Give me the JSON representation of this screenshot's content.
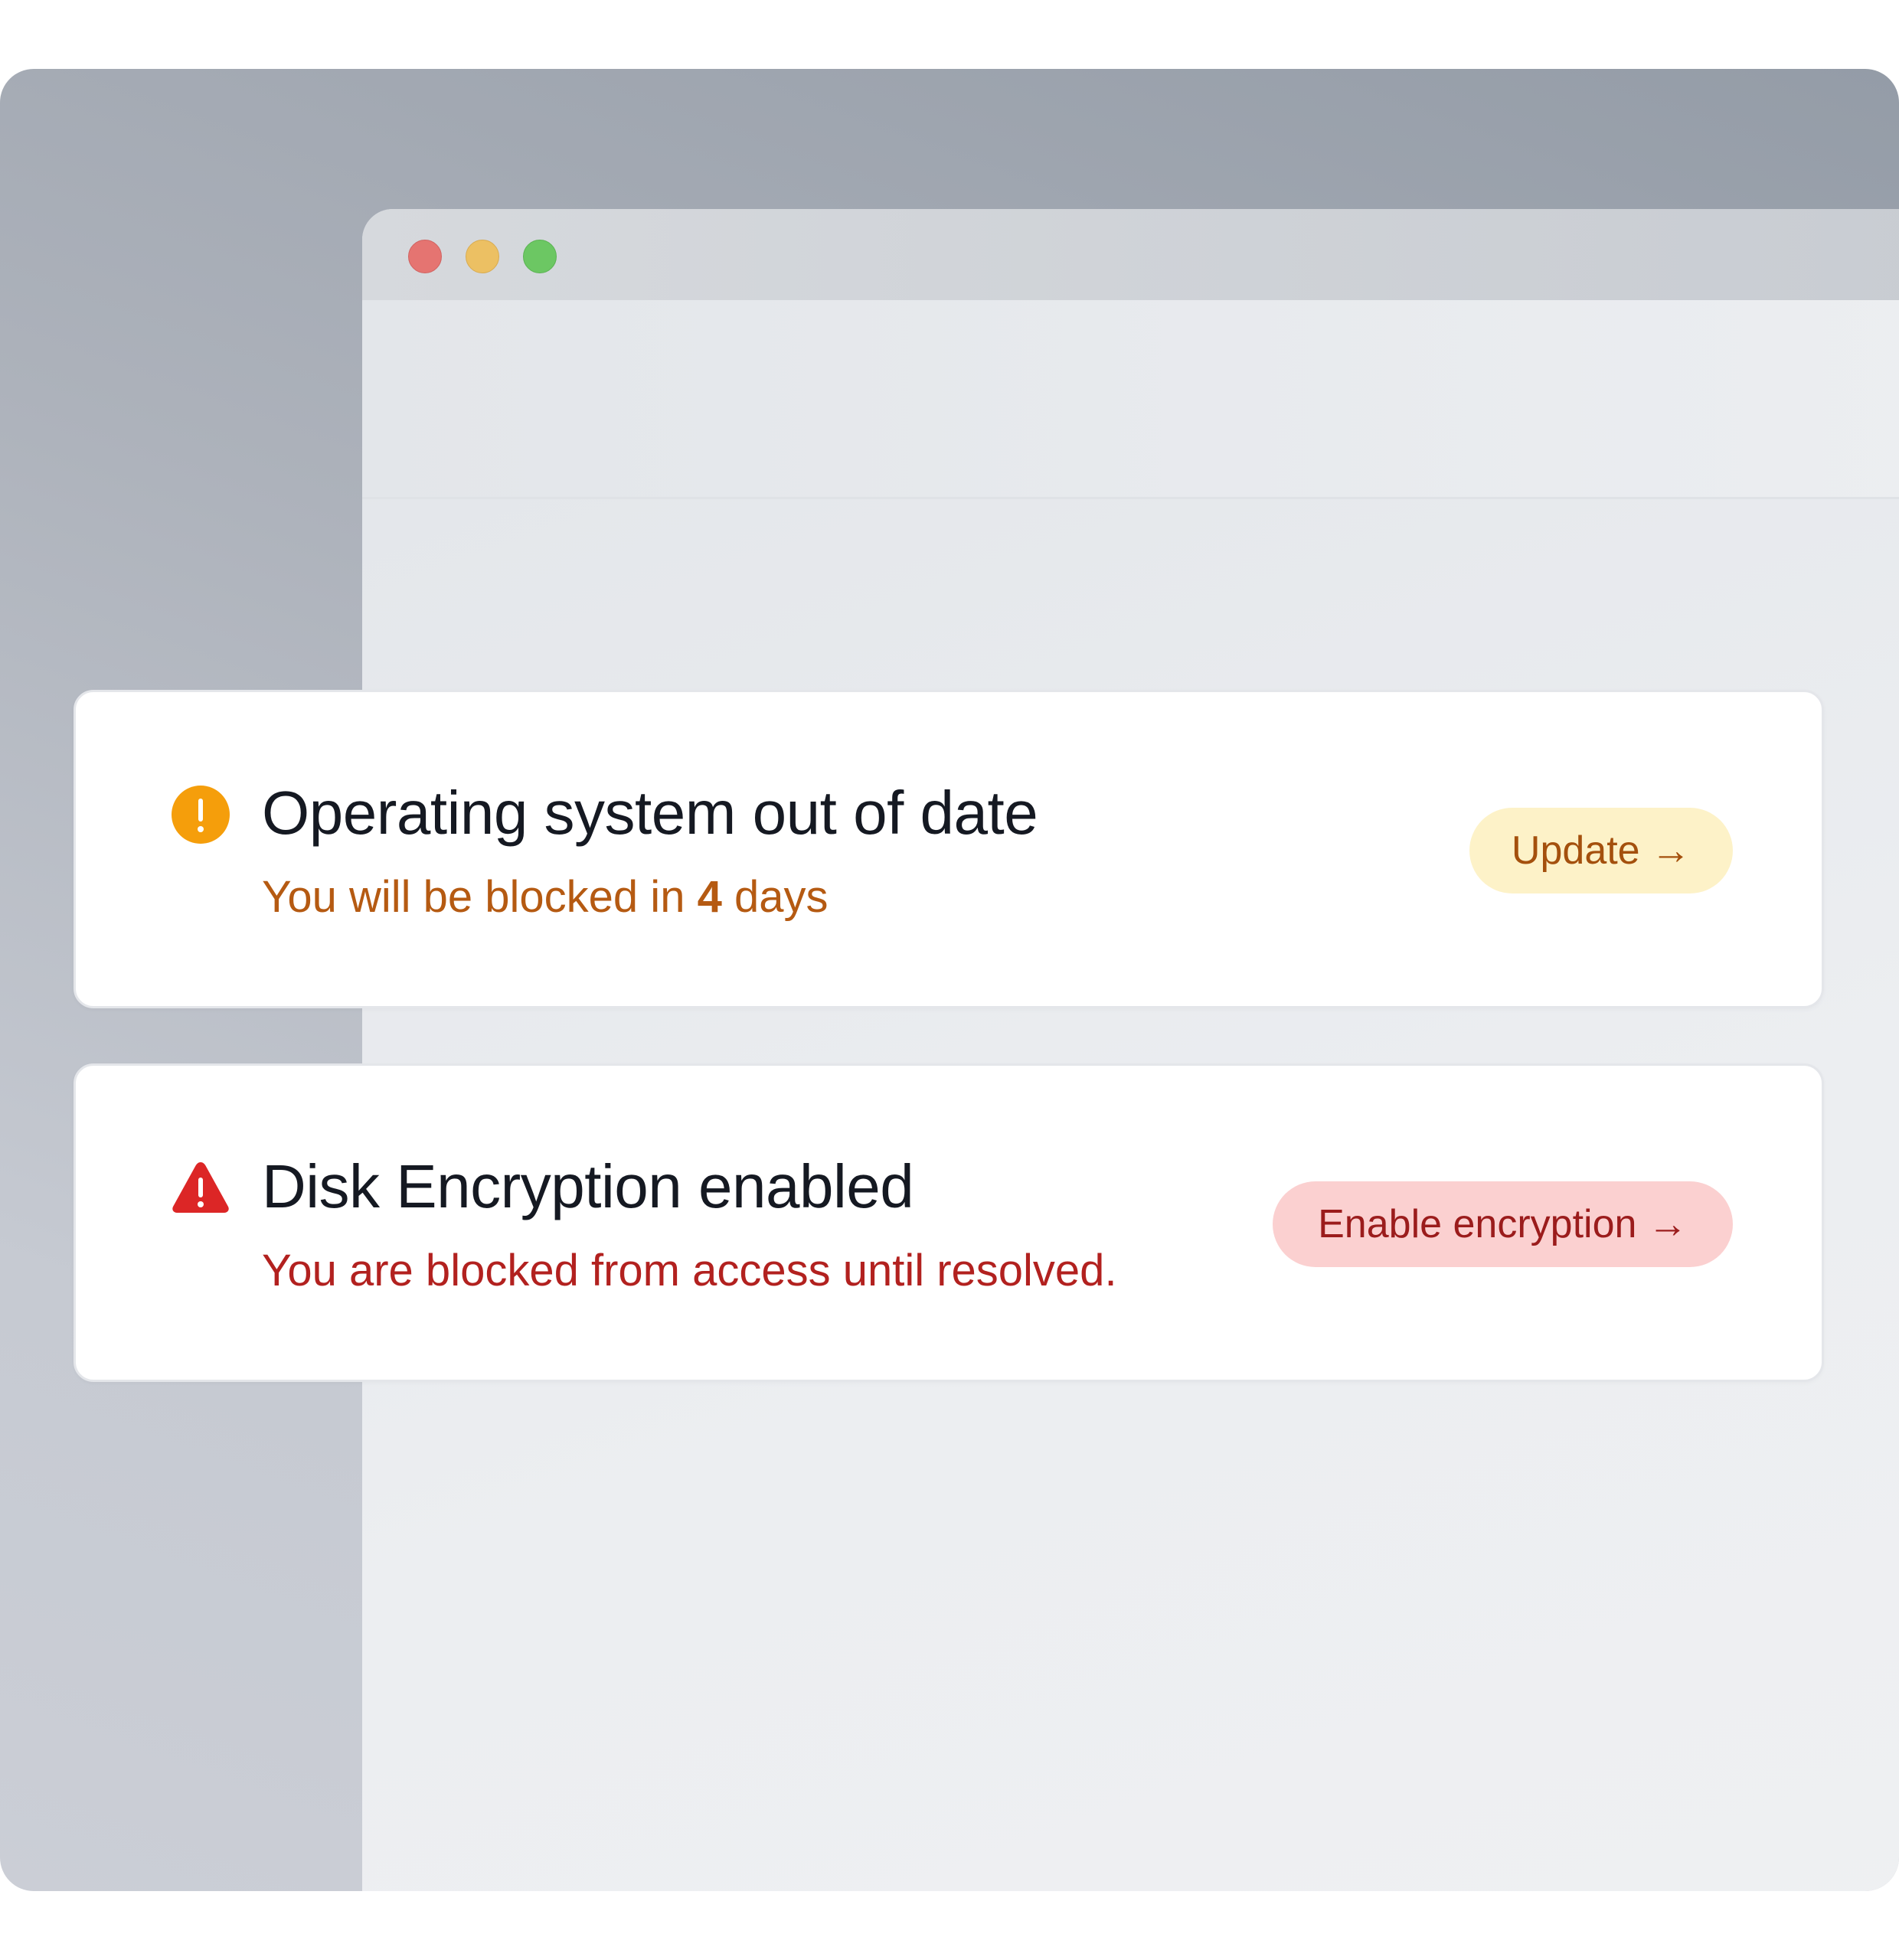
{
  "window": {
    "controls": [
      "close",
      "minimize",
      "zoom"
    ]
  },
  "cards": [
    {
      "title": "Operating system out of date",
      "subtitle_prefix": "You will be blocked in ",
      "subtitle_bold": "4",
      "subtitle_suffix": " days",
      "action_label": "Update →",
      "icon": "exclamation-circle-icon",
      "accent": "#f59e0b"
    },
    {
      "title": "Disk Encryption enabled",
      "subtitle": "You are blocked from access until resolved.",
      "action_label": "Enable encryption →",
      "icon": "warning-triangle-icon",
      "accent": "#dc2626"
    }
  ],
  "colors": {
    "warning_text": "#b55a12",
    "warning_button_bg": "#fdf2c8",
    "error_text": "#b2211f",
    "error_button_bg": "#fbd0d0",
    "title_text": "#151922"
  }
}
